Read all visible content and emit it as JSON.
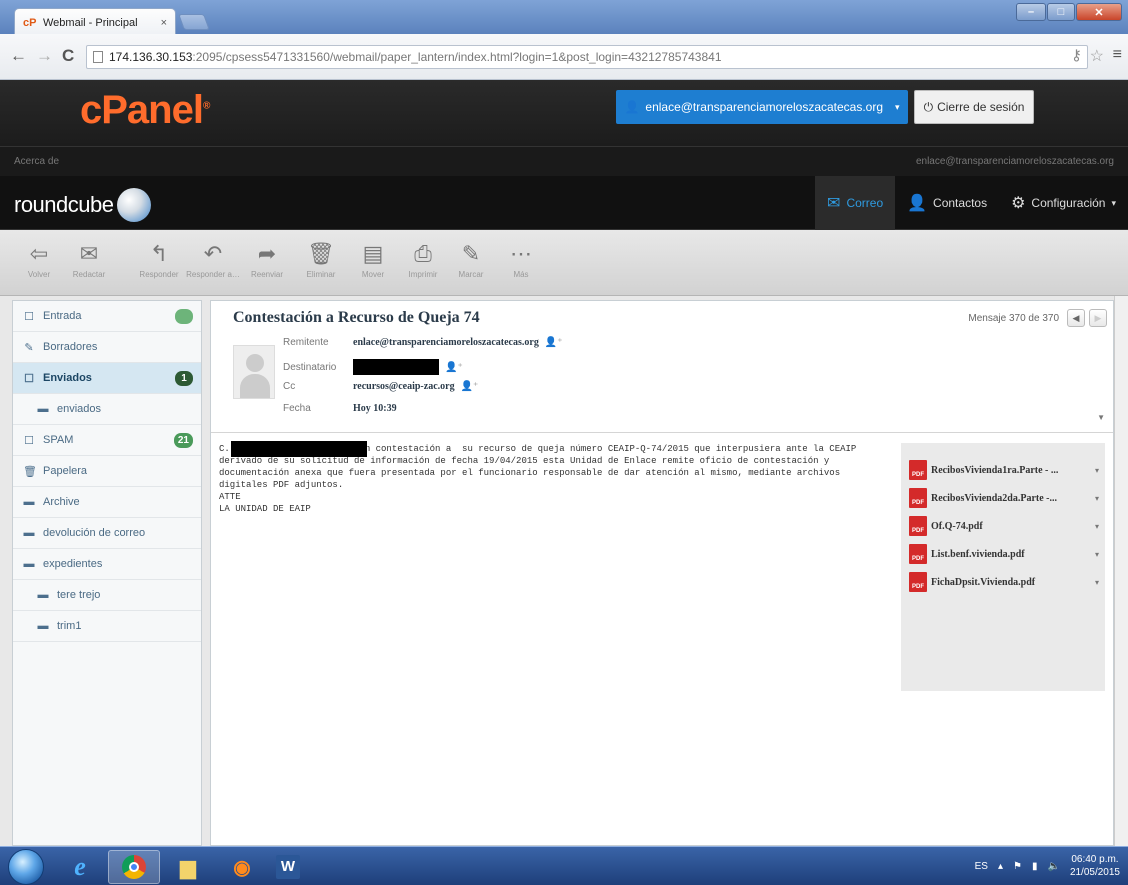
{
  "browser": {
    "tab_title": "Webmail - Principal",
    "tab_close": "×",
    "url_host": "174.136.30.153",
    "url_rest": ":2095/cpsess5471331560/webmail/paper_lantern/index.html?login=1&post_login=43212785743841",
    "back": "←",
    "forward": "→",
    "reload": "C"
  },
  "cpanel": {
    "logo": "cPanel",
    "user": "enlace@transparenciamoreloszacatecas.org",
    "logout": "Cierre de sesión",
    "about": "Acerca de",
    "about_email": "enlace@transparenciamoreloszacatecas.org"
  },
  "roundcube": {
    "logo": "roundcube",
    "nav": [
      {
        "label": "Correo",
        "icon": "mail-icon"
      },
      {
        "label": "Contactos",
        "icon": "person-icon"
      },
      {
        "label": "Configuración",
        "icon": "gear-icon"
      }
    ]
  },
  "toolbar": [
    {
      "label": "Volver",
      "icon": "back-arrow-icon"
    },
    {
      "label": "Redactar",
      "icon": "compose-icon"
    },
    {
      "label": "Responder",
      "icon": "reply-icon"
    },
    {
      "label": "Responder a…",
      "icon": "reply-all-icon"
    },
    {
      "label": "Reenviar",
      "icon": "forward-icon"
    },
    {
      "label": "Eliminar",
      "icon": "trash-icon"
    },
    {
      "label": "Mover",
      "icon": "move-icon"
    },
    {
      "label": "Imprimir",
      "icon": "print-icon"
    },
    {
      "label": "Marcar",
      "icon": "mark-icon"
    },
    {
      "label": "Más",
      "icon": "more-icon"
    }
  ],
  "folders": [
    {
      "label": "Entrada",
      "badge": "",
      "sub": false,
      "selected": false
    },
    {
      "label": "Borradores",
      "badge": "",
      "sub": false,
      "selected": false
    },
    {
      "label": "Enviados",
      "badge": "1",
      "sub": false,
      "selected": true
    },
    {
      "label": "enviados",
      "badge": "",
      "sub": true,
      "selected": false
    },
    {
      "label": "SPAM",
      "badge": "21",
      "sub": false,
      "selected": false
    },
    {
      "label": "Papelera",
      "badge": "",
      "sub": false,
      "selected": false
    },
    {
      "label": "Archive",
      "badge": "",
      "sub": false,
      "selected": false
    },
    {
      "label": "devolución de correo",
      "badge": "",
      "sub": false,
      "selected": false
    },
    {
      "label": "expedientes",
      "badge": "",
      "sub": false,
      "selected": false
    },
    {
      "label": "tere trejo",
      "badge": "",
      "sub": true,
      "selected": false
    },
    {
      "label": "trim1",
      "badge": "",
      "sub": true,
      "selected": false
    }
  ],
  "message": {
    "subject": "Contestación a Recurso de Queja 74",
    "count": "Mensaje 370 de 370",
    "labels": {
      "from": "Remitente",
      "to": "Destinatario",
      "cc": "Cc",
      "date": "Fecha"
    },
    "from": "enlace@transparenciamoreloszacatecas.org",
    "cc": "recursos@ceaip-zac.org",
    "date": "Hoy 10:39",
    "body": [
      "C.                        en contestación a  su recurso de queja número CEAIP-Q-74/2015 que interpusiera ante la CEAIP",
      "derivado de su solicitud de información de fecha 19/04/2015 esta Unidad de Enlace remite oficio de contestación y",
      "documentación anexa que fuera presentada por el funcionario responsable de dar atención al mismo, mediante archivos",
      "digitales PDF adjuntos.",
      "",
      "ATTE",
      "",
      "LA UNIDAD DE EAIP"
    ],
    "attachments": [
      "RecibosVivienda1ra.Parte - ...",
      "RecibosVivienda2da.Parte -...",
      "Of.Q-74.pdf",
      "List.benf.vivienda.pdf",
      "FichaDpsit.Vivienda.pdf"
    ]
  },
  "taskbar": {
    "lang": "ES",
    "time": "06:40 p.m.",
    "date": "21/05/2015"
  }
}
